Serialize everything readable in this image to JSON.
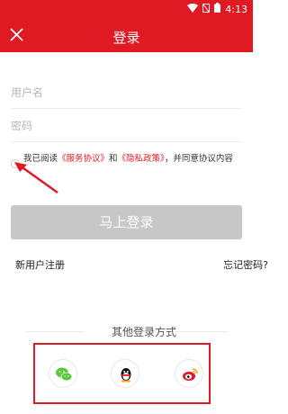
{
  "status": {
    "time": "4:13"
  },
  "header": {
    "title": "登录"
  },
  "form": {
    "username_placeholder": "用户名",
    "password_placeholder": "密码"
  },
  "agreement": {
    "prefix": "我已阅读",
    "service_link": "《服务协议》",
    "and": "和",
    "privacy_link": "《隐私政策》",
    "suffix": "，并同意协议内容"
  },
  "actions": {
    "login_label": "马上登录",
    "register_label": "新用户注册",
    "forgot_label": "忘记密码?"
  },
  "other_login": {
    "title": "其他登录方式",
    "providers": [
      "wechat",
      "qq",
      "weibo"
    ]
  },
  "colors": {
    "brand": "#e01a22",
    "button_disabled": "#c7c7c7",
    "wechat": "#5cc93b",
    "weibo": "#e6162d"
  }
}
